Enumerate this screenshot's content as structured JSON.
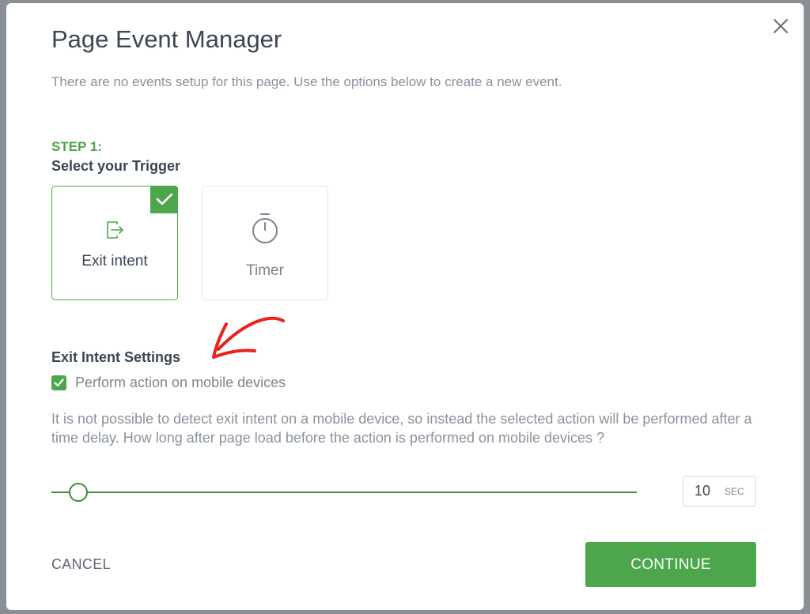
{
  "modal": {
    "title": "Page Event Manager",
    "subtitle": "There are no events setup for this page. Use the options below to create a new event.",
    "close_icon": "close-icon"
  },
  "step1": {
    "label": "STEP 1:",
    "title": "Select your Trigger",
    "triggers": [
      {
        "label": "Exit intent",
        "icon": "exit-icon",
        "selected": true
      },
      {
        "label": "Timer",
        "icon": "stopwatch-icon",
        "selected": false
      }
    ]
  },
  "exit_settings": {
    "title": "Exit Intent Settings",
    "mobile_checkbox_label": "Perform action on mobile devices",
    "mobile_checked": true,
    "info": "It is not possible to detect exit intent on a mobile device, so instead the selected action will be performed after a time delay. How long after page load before the action is performed on mobile devices ?",
    "delay_value": "10",
    "delay_unit": "SEC"
  },
  "actions": {
    "cancel_label": "CANCEL",
    "continue_label": "CONTINUE"
  },
  "colors": {
    "accent": "#4ca64c",
    "slider": "#3d8c3d",
    "annotation_arrow": "#e8221b"
  }
}
